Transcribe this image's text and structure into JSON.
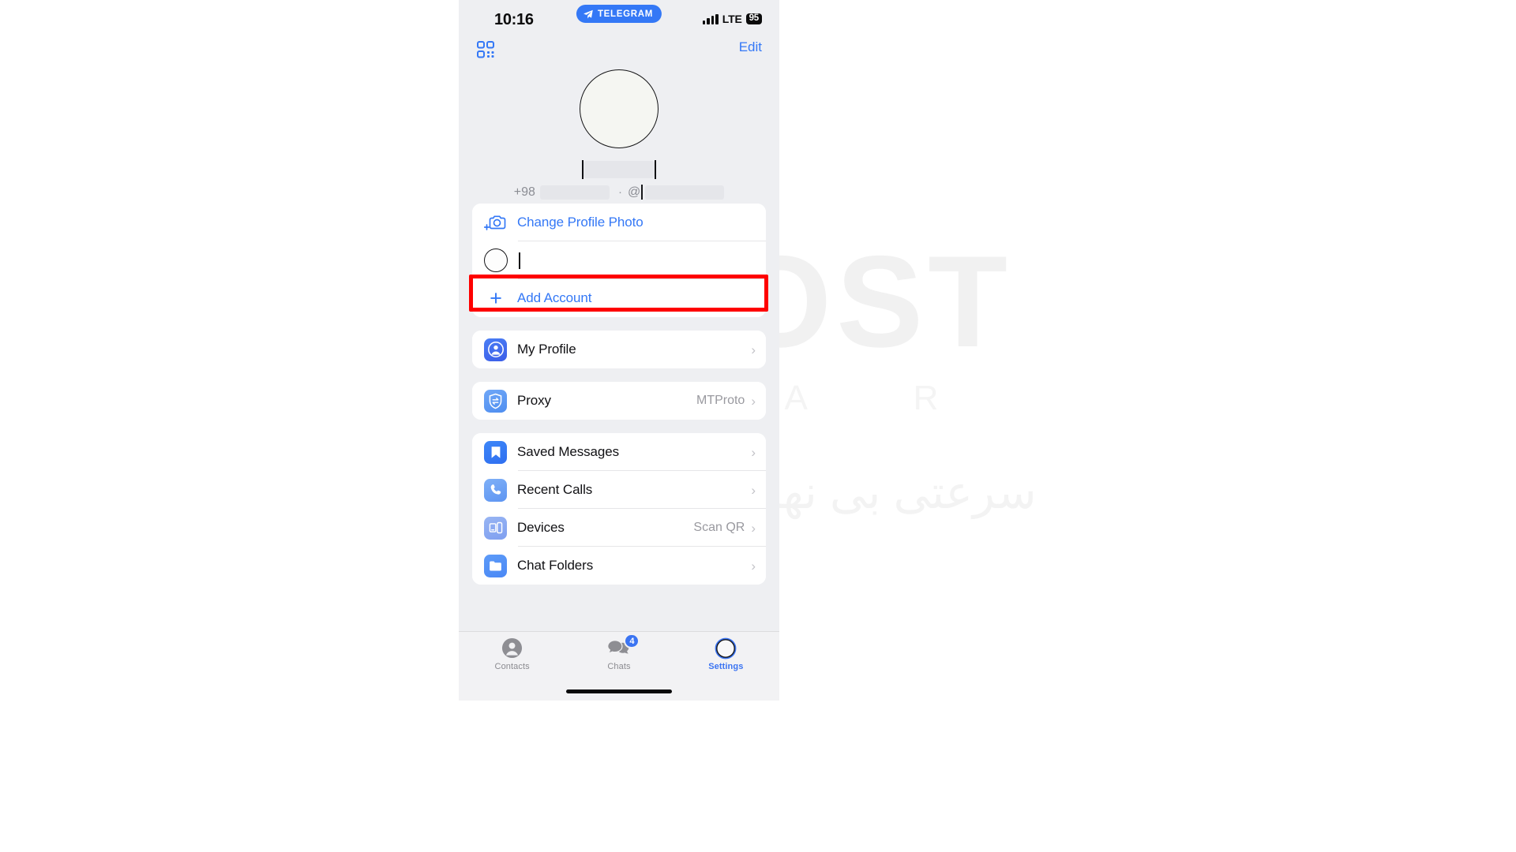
{
  "statusbar": {
    "time": "10:16",
    "app_pill": "TELEGRAM",
    "network": "LTE",
    "battery": "95",
    "signal_icon": "signal-bars-icon",
    "pill_icon": "telegram-paper-plane-icon"
  },
  "nav": {
    "qr_icon": "qr-code-scan-icon",
    "edit_label": "Edit"
  },
  "profile": {
    "avatar_icon": "user-avatar-placeholder",
    "name_redacted": true,
    "country_code": "+98",
    "separator": "·",
    "username_prefix": "@",
    "phone_redacted": true,
    "username_redacted": true
  },
  "actions": {
    "change_photo_label": "Change Profile Photo",
    "change_photo_icon": "add-camera-icon",
    "account_row_label": "",
    "account_avatar_icon": "account-avatar-icon",
    "add_account_label": "Add Account",
    "add_account_icon": "plus-icon"
  },
  "settings_groups": [
    {
      "rows": [
        {
          "label": "My Profile",
          "value": "",
          "icon": "person-circle-icon",
          "chevron": "›"
        }
      ]
    },
    {
      "rows": [
        {
          "label": "Proxy",
          "value": "MTProto",
          "icon": "proxy-shield-icon",
          "chevron": "›"
        }
      ]
    },
    {
      "rows": [
        {
          "label": "Saved Messages",
          "value": "",
          "icon": "bookmark-icon",
          "chevron": "›"
        },
        {
          "label": "Recent Calls",
          "value": "",
          "icon": "phone-icon",
          "chevron": "›"
        },
        {
          "label": "Devices",
          "value": "Scan QR",
          "icon": "devices-icon",
          "chevron": "›"
        },
        {
          "label": "Chat Folders",
          "value": "",
          "icon": "folder-icon",
          "chevron": "›"
        }
      ]
    }
  ],
  "tabbar": {
    "tabs": [
      {
        "label": "Contacts",
        "icon": "contacts-person-icon",
        "badge": "",
        "active": false
      },
      {
        "label": "Chats",
        "icon": "chat-bubbles-icon",
        "badge": "4",
        "active": false
      },
      {
        "label": "Settings",
        "icon": "settings-avatar-ring-icon",
        "badge": "",
        "active": true
      }
    ]
  },
  "annotation": {
    "highlight_color": "#fe0000",
    "target": "account-switcher-row"
  },
  "watermark": {
    "main": "WHOST",
    "line2": "A Z A R",
    "line3": "سرعتی بی نهایت میزبانی وب"
  },
  "colors": {
    "accent": "#3478f6",
    "background": "#eeeff2",
    "card": "#ffffff",
    "secondary_text": "#99999f"
  }
}
